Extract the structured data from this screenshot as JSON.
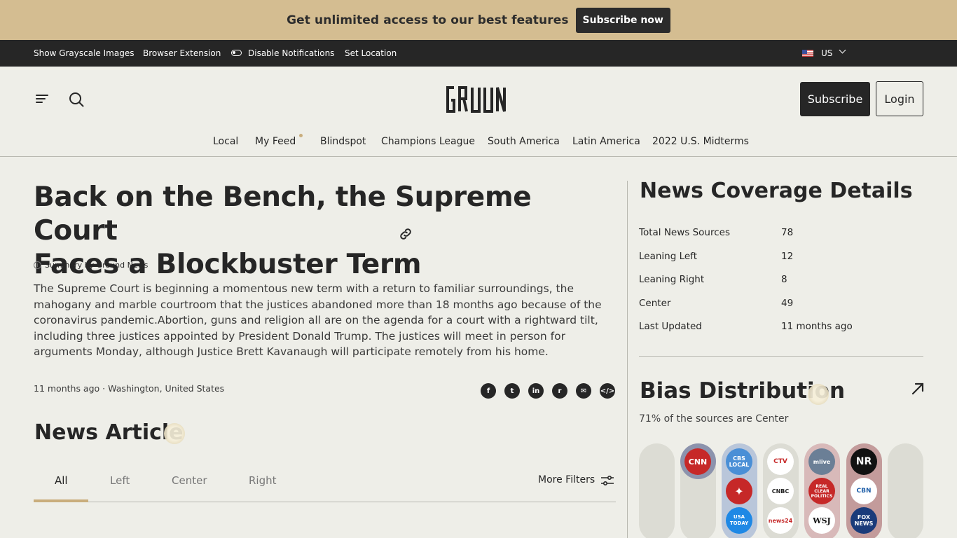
{
  "promo": {
    "text": "Get unlimited access to our best features",
    "button": "Subscribe now"
  },
  "topbar": {
    "grayscale": "Show Grayscale Images",
    "extension": "Browser Extension",
    "notifications": "Disable Notifications",
    "location": "Set Location",
    "region": "US"
  },
  "header": {
    "logo": "GROUND",
    "subscribe": "Subscribe",
    "login": "Login",
    "nav": [
      "Local",
      "My Feed",
      "Blindspot",
      "Champions League",
      "South America",
      "Latin America",
      "2022 U.S. Midterms"
    ]
  },
  "article": {
    "title_line1": "Back on the Bench, the Supreme Court",
    "title_line2": "Faces a Blockbuster Term",
    "summary_by": "Summary by Ground News",
    "summary": "The Supreme Court is beginning a momentous new term with a return to familiar surroundings, the mahogany and marble courtroom that the justices abandoned more than 18 months ago because of the coronavirus pandemic.Abortion, guns and religion all are on the agenda for a court with a rightward tilt, including three justices appointed by President Donald Trump. The justices will meet in person for arguments Monday, although Justice Brett Kavanaugh will participate remotely from his home.",
    "time": "11 months ago",
    "separator": "·",
    "place": "Washington, United States"
  },
  "share_icons": [
    "facebook-icon",
    "twitter-icon",
    "linkedin-icon",
    "reddit-icon",
    "email-icon",
    "embed-icon"
  ],
  "news_articles": {
    "heading": "News Article",
    "tabs": [
      "All",
      "Left",
      "Center",
      "Right"
    ],
    "more_filters": "More Filters"
  },
  "coverage": {
    "title": "News Coverage Details",
    "rows": [
      {
        "label": "Total News Sources",
        "value": "78"
      },
      {
        "label": "Leaning Left",
        "value": "12"
      },
      {
        "label": "Leaning Right",
        "value": "8"
      },
      {
        "label": "Center",
        "value": "49"
      },
      {
        "label": "Last Updated",
        "value": "11 months ago"
      }
    ]
  },
  "bias": {
    "title": "Bias Distribution",
    "subtitle": "71% of the sources are Center",
    "sources": [
      "CNN",
      "CBS LOCAL",
      "CTV",
      "mlive",
      "NR",
      "USA TODAY",
      "CNBC",
      "REAL CLEAR POLITICS",
      "CBN",
      "news24",
      "WSJ",
      "FOX NEWS"
    ]
  },
  "colors": {
    "accent": "#c9ad7c",
    "promo": "#d4bd91",
    "dark": "#262626",
    "background": "#eeeee8"
  }
}
